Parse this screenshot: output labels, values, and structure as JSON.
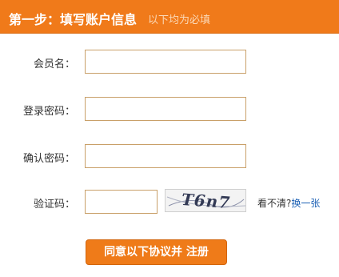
{
  "header": {
    "title": "第一步：填写账户信息",
    "subtitle": "以下均为必填"
  },
  "form": {
    "username_label": "会员名：",
    "password_label": "登录密码：",
    "confirm_label": "确认密码：",
    "captcha_label": "验证码：",
    "username_value": "",
    "password_value": "",
    "confirm_value": "",
    "captcha_value": ""
  },
  "captcha": {
    "image_text": "T6n7",
    "hint_question": "看不清?",
    "refresh_link": "换一张"
  },
  "submit": {
    "label": "同意以下协议并 注册"
  },
  "colors": {
    "accent": "#f07a1a",
    "field_border": "#c9a069",
    "link": "#1a5fb4"
  }
}
